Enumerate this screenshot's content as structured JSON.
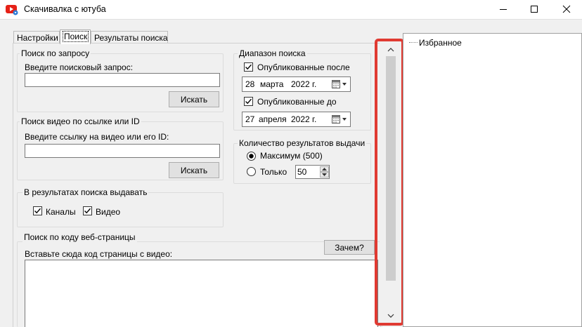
{
  "window": {
    "title": "Скачивалка с ютуба",
    "icon": "youtube-download-icon",
    "controls": [
      "minimize-icon",
      "maximize-icon",
      "close-icon"
    ]
  },
  "tabs": [
    {
      "label": "Настройки",
      "active": false
    },
    {
      "label": "Поиск",
      "active": true
    },
    {
      "label": "Результаты поиска",
      "active": false
    }
  ],
  "search_query": {
    "legend": "Поиск по запросу",
    "prompt": "Введите поисковый запрос:",
    "value": "",
    "button": "Искать"
  },
  "search_link": {
    "legend": "Поиск видео по ссылке или ID",
    "prompt": "Введите ссылку на видео или его ID:",
    "value": "",
    "button": "Искать"
  },
  "results_include": {
    "legend": "В результатах поиска выдавать",
    "channels": {
      "label": "Каналы",
      "checked": true
    },
    "videos": {
      "label": "Видео",
      "checked": true
    }
  },
  "page_code": {
    "legend": "Поиск по коду веб-страницы",
    "prompt": "Вставьте сюда код страницы с видео:",
    "why_button": "Зачем?",
    "value": ""
  },
  "date_range": {
    "legend": "Диапазон поиска",
    "published_after": {
      "label": "Опубликованные после",
      "checked": true,
      "day": "28",
      "month": "марта",
      "year": "2022 г."
    },
    "published_before": {
      "label": "Опубликованные до",
      "checked": true,
      "day": "27",
      "month": "апреля",
      "year": "2022 г."
    }
  },
  "results_count": {
    "legend": "Количество результатов выдачи",
    "maximum": {
      "label": "Максимум (500)",
      "selected": true
    },
    "only": {
      "label": "Только",
      "selected": false,
      "value": "50"
    }
  },
  "tree": {
    "root": "Избранное"
  },
  "colors": {
    "highlight": "#e03a32",
    "window_bg": "#f0f0f0"
  }
}
